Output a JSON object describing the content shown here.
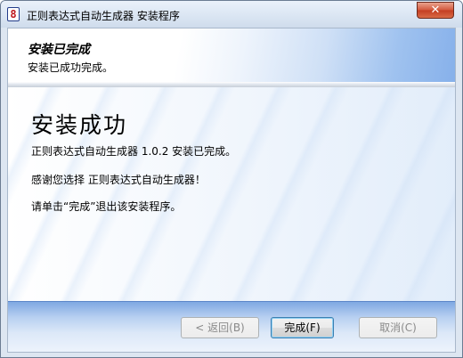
{
  "window": {
    "title": "正则表达式自动生成器 安装程序",
    "app_icon_glyph": "8",
    "close_glyph": "✕"
  },
  "header": {
    "title": "安装已完成",
    "subtitle": "安装已成功完成。"
  },
  "main": {
    "heading": "安装成功",
    "lines": [
      "正则表达式自动生成器 1.0.2 安装已完成。",
      "感谢您选择 正则表达式自动生成器！",
      "请单击“完成”退出该安装程序。"
    ]
  },
  "buttons": {
    "back": "< 返回(B)",
    "finish": "完成(F)",
    "cancel": "取消(C)"
  },
  "colors": {
    "close_button": "#c33d21",
    "header_gradient_end": "#86b0ea",
    "footer_band": "#7fa8e2"
  }
}
